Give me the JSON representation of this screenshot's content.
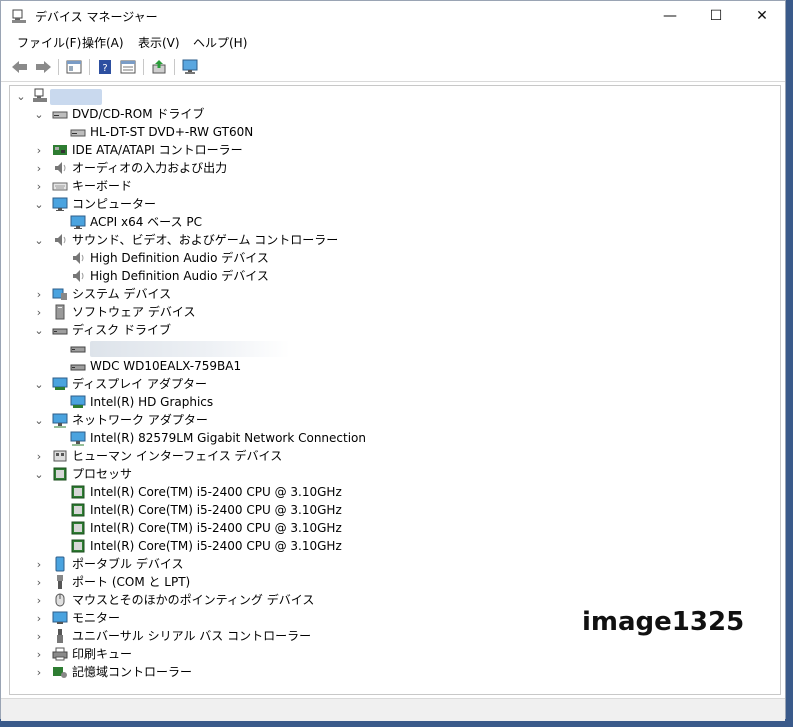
{
  "window": {
    "title": "デバイス マネージャー"
  },
  "caption": {
    "minimize": "—",
    "maximize": "☐",
    "close": "✕"
  },
  "menu": [
    "ファイル(F)",
    "操作(A)",
    "表示(V)",
    "ヘルプ(H)"
  ],
  "toolbar": [
    "back-icon",
    "forward-icon",
    "properties-icon",
    "help-icon",
    "view-icon",
    "update-driver-icon",
    "monitor-scan-icon"
  ],
  "tree": {
    "root_label": "",
    "items": [
      {
        "label": "DVD/CD-ROM ドライブ",
        "expanded": true,
        "icon": "dvd-drive-icon",
        "children": [
          {
            "label": "HL-DT-ST DVD+-RW GT60N",
            "icon": "dvd-drive-icon"
          }
        ]
      },
      {
        "label": "IDE ATA/ATAPI コントローラー",
        "expanded": false,
        "icon": "ide-controller-icon"
      },
      {
        "label": "オーディオの入力および出力",
        "expanded": false,
        "icon": "speaker-icon"
      },
      {
        "label": "キーボード",
        "expanded": false,
        "icon": "keyboard-icon"
      },
      {
        "label": "コンピューター",
        "expanded": true,
        "icon": "computer-icon",
        "children": [
          {
            "label": "ACPI x64 ベース PC",
            "icon": "computer-icon"
          }
        ]
      },
      {
        "label": "サウンド、ビデオ、およびゲーム コントローラー",
        "expanded": true,
        "icon": "speaker-icon",
        "children": [
          {
            "label": "High Definition Audio デバイス",
            "icon": "speaker-icon"
          },
          {
            "label": "High Definition Audio デバイス",
            "icon": "speaker-icon"
          }
        ]
      },
      {
        "label": "システム デバイス",
        "expanded": false,
        "icon": "system-device-icon"
      },
      {
        "label": "ソフトウェア デバイス",
        "expanded": false,
        "icon": "software-device-icon"
      },
      {
        "label": "ディスク ドライブ",
        "expanded": true,
        "icon": "disk-drive-icon",
        "children": [
          {
            "label": "",
            "icon": "disk-drive-icon",
            "blurred": true
          },
          {
            "label": "WDC WD10EALX-759BA1",
            "icon": "disk-drive-icon"
          }
        ]
      },
      {
        "label": "ディスプレイ アダプター",
        "expanded": true,
        "icon": "display-adapter-icon",
        "children": [
          {
            "label": "Intel(R) HD Graphics",
            "icon": "display-adapter-icon"
          }
        ]
      },
      {
        "label": "ネットワーク アダプター",
        "expanded": true,
        "icon": "network-adapter-icon",
        "children": [
          {
            "label": "Intel(R) 82579LM Gigabit Network Connection",
            "icon": "network-adapter-icon"
          }
        ]
      },
      {
        "label": "ヒューマン インターフェイス デバイス",
        "expanded": false,
        "icon": "hid-icon"
      },
      {
        "label": "プロセッサ",
        "expanded": true,
        "icon": "processor-icon",
        "children": [
          {
            "label": "Intel(R) Core(TM) i5-2400 CPU @ 3.10GHz",
            "icon": "processor-icon"
          },
          {
            "label": "Intel(R) Core(TM) i5-2400 CPU @ 3.10GHz",
            "icon": "processor-icon"
          },
          {
            "label": "Intel(R) Core(TM) i5-2400 CPU @ 3.10GHz",
            "icon": "processor-icon"
          },
          {
            "label": "Intel(R) Core(TM) i5-2400 CPU @ 3.10GHz",
            "icon": "processor-icon"
          }
        ]
      },
      {
        "label": "ポータブル デバイス",
        "expanded": false,
        "icon": "portable-device-icon"
      },
      {
        "label": "ポート (COM と LPT)",
        "expanded": false,
        "icon": "port-icon"
      },
      {
        "label": "マウスとそのほかのポインティング デバイス",
        "expanded": false,
        "icon": "mouse-icon"
      },
      {
        "label": "モニター",
        "expanded": false,
        "icon": "monitor-icon"
      },
      {
        "label": "ユニバーサル シリアル バス コントローラー",
        "expanded": false,
        "icon": "usb-icon"
      },
      {
        "label": "印刷キュー",
        "expanded": false,
        "icon": "printer-icon"
      },
      {
        "label": "記憶域コントローラー",
        "expanded": false,
        "icon": "storage-controller-icon"
      }
    ]
  },
  "watermark": "image1325"
}
